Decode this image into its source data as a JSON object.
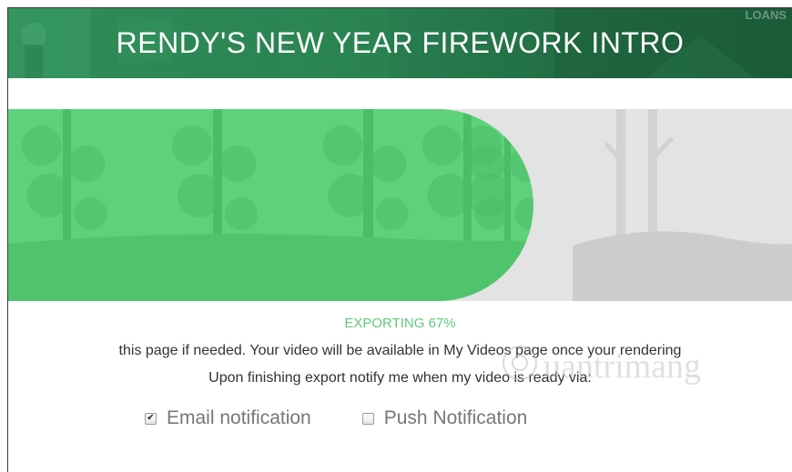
{
  "header": {
    "title": "RENDY'S NEW YEAR FIREWORK INTRO",
    "corner_text": "LOANS"
  },
  "export": {
    "status": "EXPORTING 67%",
    "progress_percent": 67,
    "message_line1": "this page if needed. Your video will be available in My Videos page once your rendering",
    "message_line2": "Upon finishing export notify me when my video is ready via:"
  },
  "notifications": {
    "email": {
      "label": "Email notification",
      "checked": true
    },
    "push": {
      "label": "Push Notification",
      "checked": false
    }
  },
  "colors": {
    "header": "#2a8352",
    "progress_fill": "#5fd17c",
    "progress_track": "#e3e3e3",
    "status_text": "#61c97b"
  }
}
